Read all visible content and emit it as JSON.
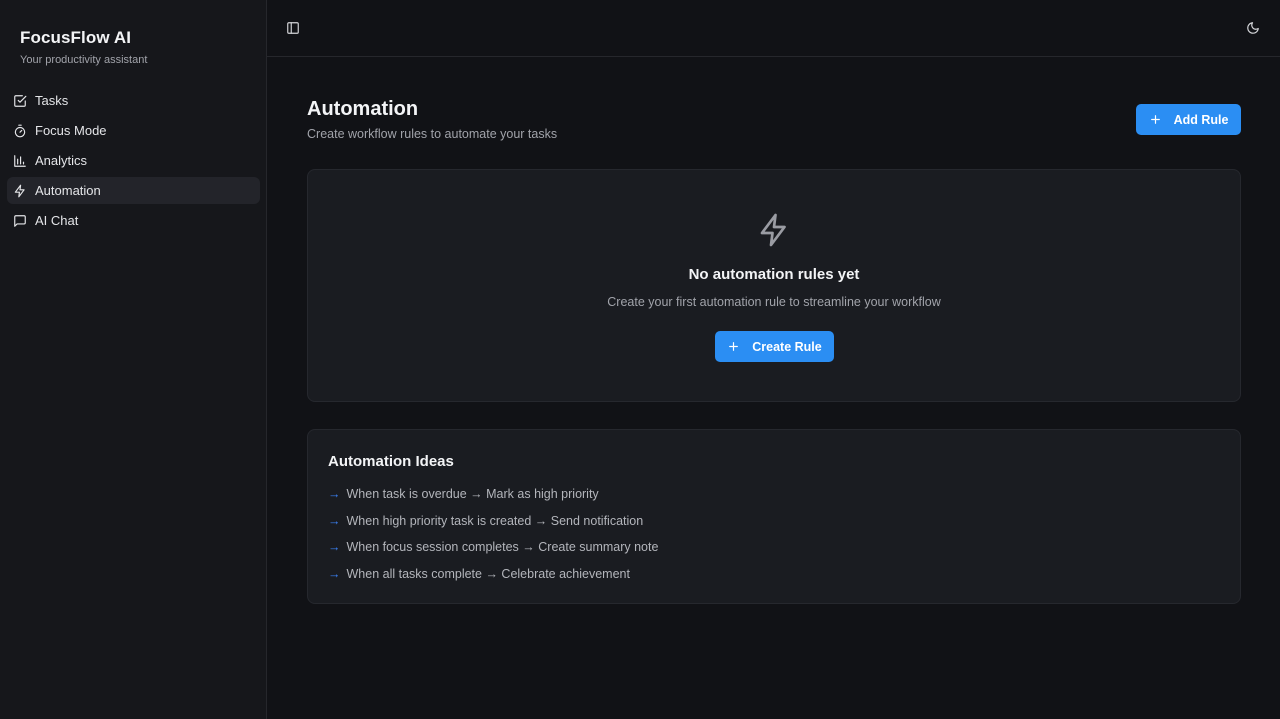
{
  "app": {
    "title": "FocusFlow AI",
    "subtitle": "Your productivity assistant"
  },
  "sidebar": {
    "items": [
      {
        "label": "Tasks",
        "icon": "checkbox-icon",
        "active": false
      },
      {
        "label": "Focus Mode",
        "icon": "timer-icon",
        "active": false
      },
      {
        "label": "Analytics",
        "icon": "bar-chart-icon",
        "active": false
      },
      {
        "label": "Automation",
        "icon": "zap-icon",
        "active": true
      },
      {
        "label": "AI Chat",
        "icon": "message-square-icon",
        "active": false
      }
    ]
  },
  "topbar": {
    "sidebar_toggle_icon": "panel-left-icon",
    "theme_toggle_icon": "moon-icon"
  },
  "page": {
    "title": "Automation",
    "subtitle": "Create workflow rules to automate your tasks",
    "add_rule_label": "Add Rule"
  },
  "empty_state": {
    "icon": "zap-icon",
    "title": "No automation rules yet",
    "subtitle": "Create your first automation rule to streamline your workflow",
    "button_label": "Create Rule"
  },
  "ideas": {
    "title": "Automation Ideas",
    "bullet": "→",
    "items": [
      "When task is overdue → Mark as high priority",
      "When high priority task is created → Send notification",
      "When focus session completes → Create summary note",
      "When all tasks complete → Celebrate achievement"
    ]
  },
  "colors": {
    "accent": "#2b8ef3",
    "background": "#111216",
    "sidebar": "#16171b",
    "card": "#1a1c21"
  }
}
